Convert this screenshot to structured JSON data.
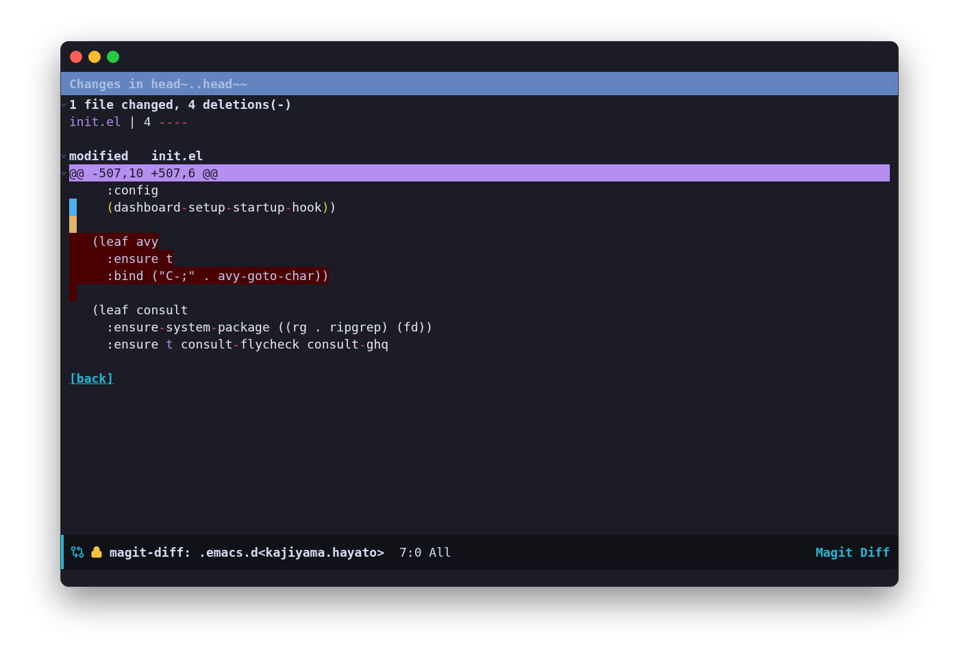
{
  "header": {
    "title": "Changes in head~..head~~"
  },
  "summary": {
    "expanded": true,
    "text": "1 file changed, 4 deletions(-)"
  },
  "diffstat": {
    "file": "init.el",
    "separator": "|",
    "count": "4",
    "bar": "----"
  },
  "file_section": {
    "expanded": true,
    "status": "modified",
    "file": "init.el"
  },
  "hunk": {
    "expanded": true,
    "header": "@@ -507,10 +507,6 @@",
    "lines": [
      {
        "kind": "context",
        "segments": [
          {
            "text": "    :config"
          }
        ]
      },
      {
        "kind": "context",
        "color": "#4fb0ee",
        "segments": [
          {
            "text": "    (",
            "color": "#f5c542"
          },
          {
            "text": "dashboard"
          },
          {
            "text": "-",
            "color": "#e0457b"
          },
          {
            "text": "setup"
          },
          {
            "text": "-",
            "color": "#e0457b"
          },
          {
            "text": "startup"
          },
          {
            "text": "-",
            "color": "#e0457b"
          },
          {
            "text": "hook"
          },
          {
            "text": ")",
            "color": "#f5c542"
          },
          {
            "text": ")"
          }
        ]
      },
      {
        "kind": "context",
        "color": "#e0b46e"
      },
      {
        "kind": "removed",
        "segments": [
          {
            "text": "  (leaf avy"
          }
        ]
      },
      {
        "kind": "removed",
        "segments": [
          {
            "text": "    :ensure t"
          }
        ]
      },
      {
        "kind": "removed",
        "segments": [
          {
            "text": "    :bind (\"C-;\" . avy-goto-char))"
          }
        ]
      },
      {
        "kind": "removed"
      },
      {
        "kind": "context",
        "segments": [
          {
            "text": "  (leaf consult"
          }
        ]
      },
      {
        "kind": "context",
        "segments": [
          {
            "text": "    :ensure"
          },
          {
            "text": "-",
            "color": "#e0457b"
          },
          {
            "text": "system"
          },
          {
            "text": "-",
            "color": "#e0457b"
          },
          {
            "text": "package ((rg . ripgrep) (fd))"
          }
        ]
      },
      {
        "kind": "context",
        "segments": [
          {
            "text": "    :ensure "
          },
          {
            "text": "t",
            "color": "#b18be8"
          },
          {
            "text": " consult"
          },
          {
            "text": "-",
            "color": "#e0457b"
          },
          {
            "text": "flycheck consult"
          },
          {
            "text": "-",
            "color": "#e0457b"
          },
          {
            "text": "ghq"
          }
        ]
      }
    ]
  },
  "back_link": "[back]",
  "mode_line": {
    "buffer": "magit-diff: .emacs.d<kajiyama.hayato>",
    "position": "7:0 All",
    "mode": "Magit Diff"
  }
}
